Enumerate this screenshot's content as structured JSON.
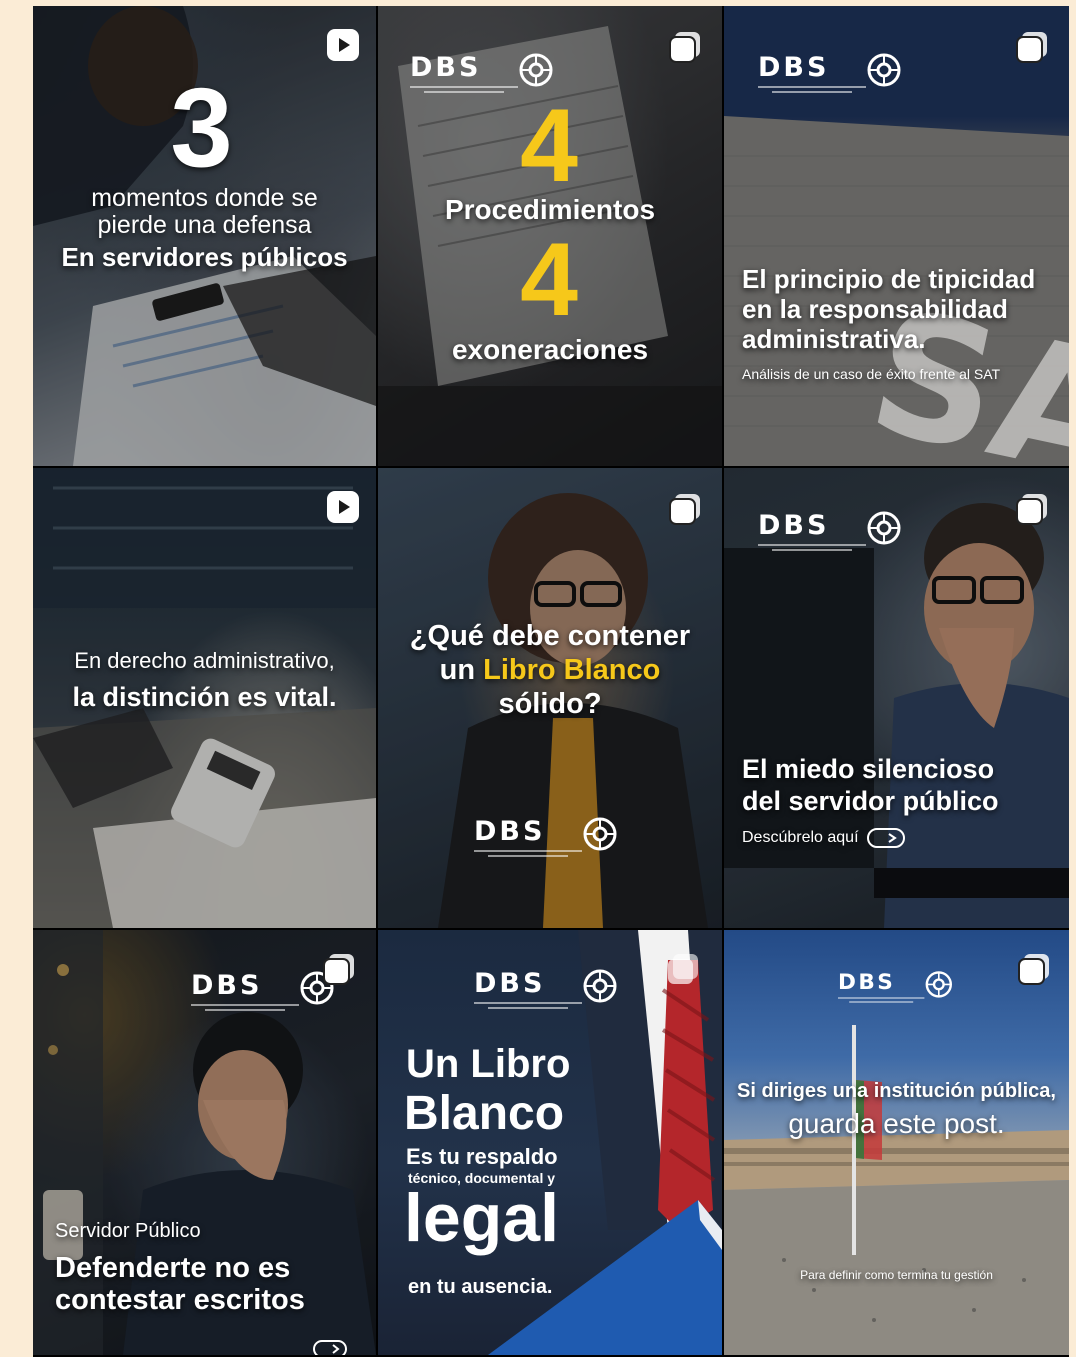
{
  "posts": [
    {
      "type_icon": "reel-icon",
      "big_number": "3",
      "line1": "momentos donde se",
      "line2": "pierde una defensa",
      "line3": "En servidores públicos"
    },
    {
      "type_icon": "carousel-icon",
      "logo": "DBS",
      "number1": "4",
      "word1": "Procedimientos",
      "number2": "4",
      "word2": "exoneraciones"
    },
    {
      "type_icon": "carousel-icon",
      "logo": "DBS",
      "title1": "El principio de tipicidad",
      "title2": "en la responsabilidad",
      "title3": "administrativa.",
      "subtitle": "Análisis de un caso de éxito frente al SAT",
      "sign_text": "SAT"
    },
    {
      "type_icon": "reel-icon",
      "line1": "En derecho administrativo,",
      "line2": "la distinción es vital."
    },
    {
      "type_icon": "carousel-icon",
      "line1": "¿Qué debe contener",
      "line2_pre": "un ",
      "line2_highlight": "Libro Blanco",
      "line3": "sólido?",
      "logo": "DBS"
    },
    {
      "type_icon": "carousel-icon",
      "logo": "DBS",
      "title1": "El miedo silencioso",
      "title2": "del servidor público",
      "cta": "Descúbrelo aquí"
    },
    {
      "type_icon": "carousel-icon",
      "logo": "DBS",
      "kicker": "Servidor Público",
      "title1": "Defenderte no es",
      "title2": "contestar escritos"
    },
    {
      "type_icon": "carousel-icon",
      "logo": "DBS",
      "line1": "Un Libro",
      "line2": "Blanco",
      "line3": "Es tu respaldo",
      "line4": "técnico, documental y",
      "line5": "legal",
      "line6": "en tu ausencia."
    },
    {
      "type_icon": "carousel-icon",
      "logo": "DBS",
      "line1": "Si diriges una institución pública,",
      "line2": "guarda este post.",
      "footer": "Para definir como termina tu gestión"
    }
  ]
}
